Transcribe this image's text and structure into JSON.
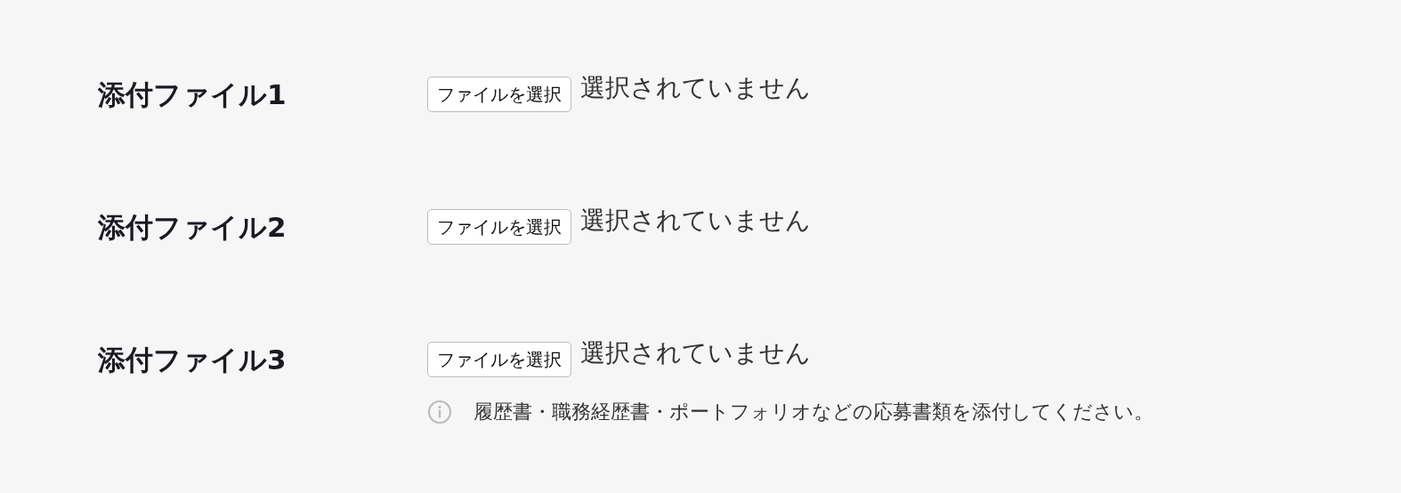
{
  "fields": [
    {
      "label": "添付ファイル1",
      "button": "ファイルを選択",
      "status": "選択されていません"
    },
    {
      "label": "添付ファイル2",
      "button": "ファイルを選択",
      "status": "選択されていません"
    },
    {
      "label": "添付ファイル3",
      "button": "ファイルを選択",
      "status": "選択されていません"
    }
  ],
  "hint": {
    "text": "履歴書・職務経歴書・ポートフォリオなどの応募書類を添付してください。"
  }
}
